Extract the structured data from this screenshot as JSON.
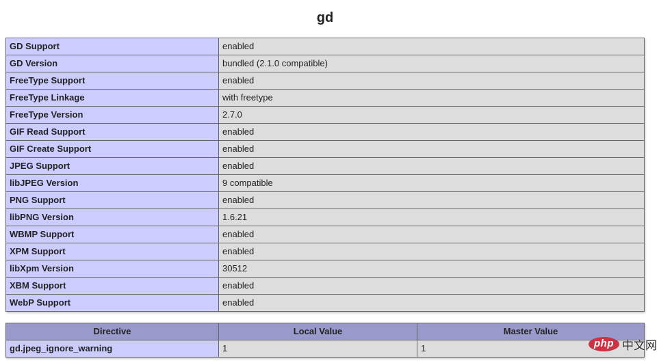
{
  "page": {
    "title": "gd"
  },
  "colors": {
    "header_bg": "#9999cc",
    "label_bg": "#ccccff",
    "value_bg": "#dddddd",
    "cell_border": "#666666",
    "text": "#222222",
    "watermark_red": "#cc3344"
  },
  "gd_table": {
    "rows": [
      {
        "label": "GD Support",
        "value": "enabled"
      },
      {
        "label": "GD Version",
        "value": "bundled (2.1.0 compatible)"
      },
      {
        "label": "FreeType Support",
        "value": "enabled"
      },
      {
        "label": "FreeType Linkage",
        "value": "with freetype"
      },
      {
        "label": "FreeType Version",
        "value": "2.7.0"
      },
      {
        "label": "GIF Read Support",
        "value": "enabled"
      },
      {
        "label": "GIF Create Support",
        "value": "enabled"
      },
      {
        "label": "JPEG Support",
        "value": "enabled"
      },
      {
        "label": "libJPEG Version",
        "value": "9 compatible"
      },
      {
        "label": "PNG Support",
        "value": "enabled"
      },
      {
        "label": "libPNG Version",
        "value": "1.6.21"
      },
      {
        "label": "WBMP Support",
        "value": "enabled"
      },
      {
        "label": "XPM Support",
        "value": "enabled"
      },
      {
        "label": "libXpm Version",
        "value": "30512"
      },
      {
        "label": "XBM Support",
        "value": "enabled"
      },
      {
        "label": "WebP Support",
        "value": "enabled"
      }
    ]
  },
  "directives_table": {
    "headers": [
      "Directive",
      "Local Value",
      "Master Value"
    ],
    "rows": [
      {
        "directive": "gd.jpeg_ignore_warning",
        "local_value": "1",
        "master_value": "1"
      }
    ]
  },
  "watermark": {
    "logo_text": "php",
    "site_text": "中文网"
  }
}
